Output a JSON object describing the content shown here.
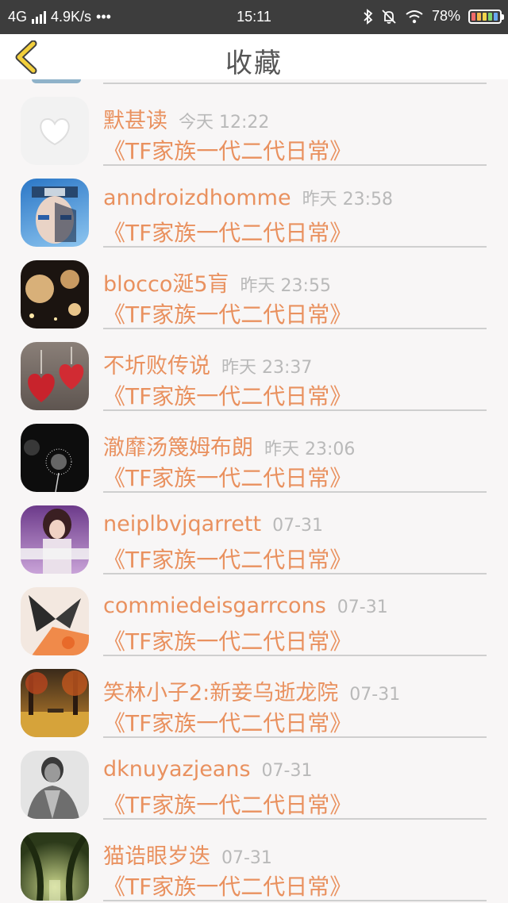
{
  "status_bar": {
    "network": "4G",
    "speed": "4.9K/s",
    "dots": "•••",
    "time": "15:11",
    "battery": "78%"
  },
  "header": {
    "title": "收藏"
  },
  "items": [
    {
      "name": "默甚读",
      "time": "今天 12:22",
      "book": "《TF家族一代二代日常》"
    },
    {
      "name": "anndroizdhomme",
      "time": "昨天 23:58",
      "book": "《TF家族一代二代日常》"
    },
    {
      "name": "blocco涎5肓",
      "time": "昨天 23:55",
      "book": "《TF家族一代二代日常》"
    },
    {
      "name": "不圻败传说",
      "time": "昨天 23:37",
      "book": "《TF家族一代二代日常》"
    },
    {
      "name": "澈靡汤篾姆布朗",
      "time": "昨天 23:06",
      "book": "《TF家族一代二代日常》"
    },
    {
      "name": "neiplbvjqarrett",
      "time": "07-31",
      "book": "《TF家族一代二代日常》"
    },
    {
      "name": "commiedeisgarrcons",
      "time": "07-31",
      "book": "《TF家族一代二代日常》"
    },
    {
      "name": "笑林小子2:新妾乌逝龙院",
      "time": "07-31",
      "book": "《TF家族一代二代日常》"
    },
    {
      "name": "dknuyazjeans",
      "time": "07-31",
      "book": "《TF家族一代二代日常》"
    },
    {
      "name": "猫诰眼岁迭",
      "time": "07-31",
      "book": "《TF家族一代二代日常》"
    }
  ]
}
